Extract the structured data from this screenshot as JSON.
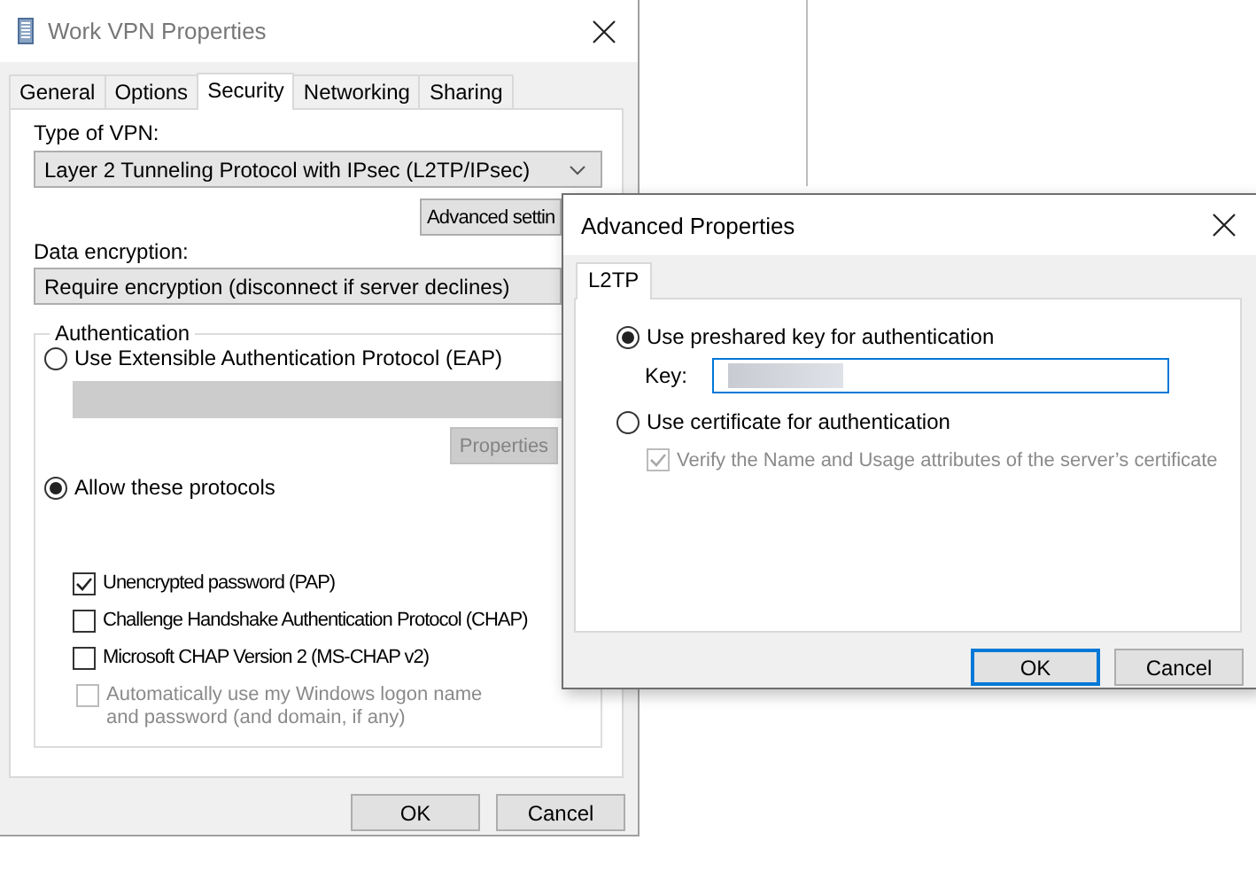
{
  "main_window": {
    "title": "Work VPN Properties",
    "tabs": [
      {
        "label": "General",
        "selected": false
      },
      {
        "label": "Options",
        "selected": false
      },
      {
        "label": "Security",
        "selected": true
      },
      {
        "label": "Networking",
        "selected": false
      },
      {
        "label": "Sharing",
        "selected": false
      }
    ],
    "type_of_vpn": {
      "label": "Type of VPN:",
      "value": "Layer 2 Tunneling Protocol with IPsec (L2TP/IPsec)"
    },
    "advanced_button": "Advanced settin",
    "data_encryption": {
      "label": "Data encryption:",
      "value": "Require encryption (disconnect if server declines)"
    },
    "authentication": {
      "title": "Authentication",
      "eap": {
        "label": "Use Extensible Authentication Protocol (EAP)",
        "selected": false
      },
      "eap_method": {
        "disabled": true
      },
      "properties_button": {
        "label": "Properties",
        "disabled": true
      },
      "allow": {
        "label": "Allow these protocols",
        "selected": true
      },
      "protocols": [
        {
          "label": "Unencrypted password (PAP)",
          "checked": true,
          "disabled": false
        },
        {
          "label": "Challenge Handshake Authentication Protocol (CHAP)",
          "checked": false,
          "disabled": false
        },
        {
          "label": "Microsoft CHAP Version 2 (MS-CHAP v2)",
          "checked": false,
          "disabled": false,
          "children": [
            {
              "label": "Automatically use my Windows logon name and password (and domain, if any)",
              "checked": false,
              "disabled": true
            }
          ]
        }
      ]
    },
    "buttons": [
      {
        "label": "OK"
      },
      {
        "label": "Cancel"
      }
    ]
  },
  "advanced_dialog": {
    "title": "Advanced Properties",
    "tabs": [
      {
        "label": "L2TP",
        "selected": true
      }
    ],
    "preshared": {
      "label": "Use preshared key for authentication",
      "selected": true
    },
    "key": {
      "label": "Key:"
    },
    "certificate": {
      "label": "Use certificate for authentication",
      "selected": false
    },
    "verify": {
      "label": "Verify the Name and Usage attributes of the server’s certificate",
      "checked": true,
      "disabled": true
    },
    "buttons": [
      {
        "label": "OK",
        "default": true
      },
      {
        "label": "Cancel",
        "default": false
      }
    ]
  }
}
